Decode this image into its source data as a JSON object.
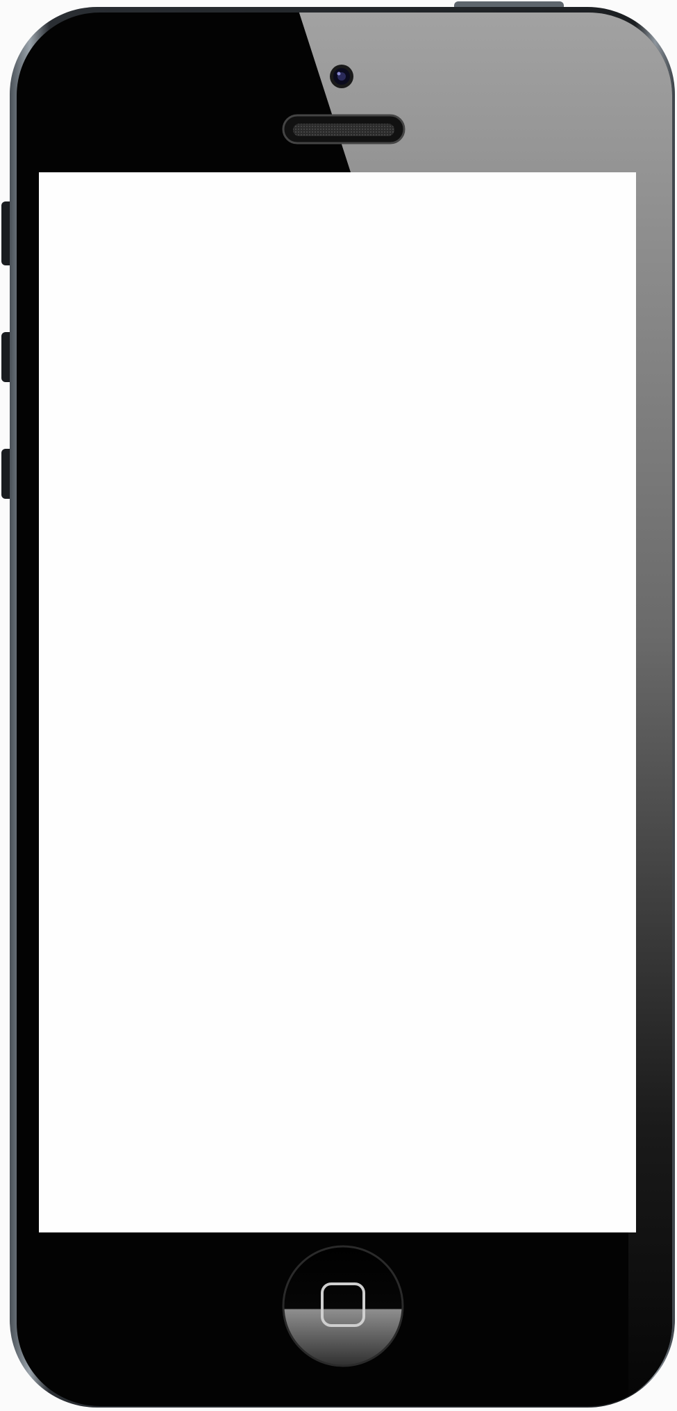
{
  "device": {
    "type": "smartphone",
    "body_color": "#030303",
    "rim_color": "#7c848c",
    "screen_color": "#fefefe",
    "glare_color": "#a6a6a6"
  },
  "icons": {
    "camera": "front-camera-icon",
    "speaker": "earpiece-speaker-icon",
    "home": "home-button-square-icon"
  },
  "buttons": {
    "side": [
      "mute-switch",
      "volume-up",
      "volume-down"
    ],
    "top": "power-button"
  }
}
